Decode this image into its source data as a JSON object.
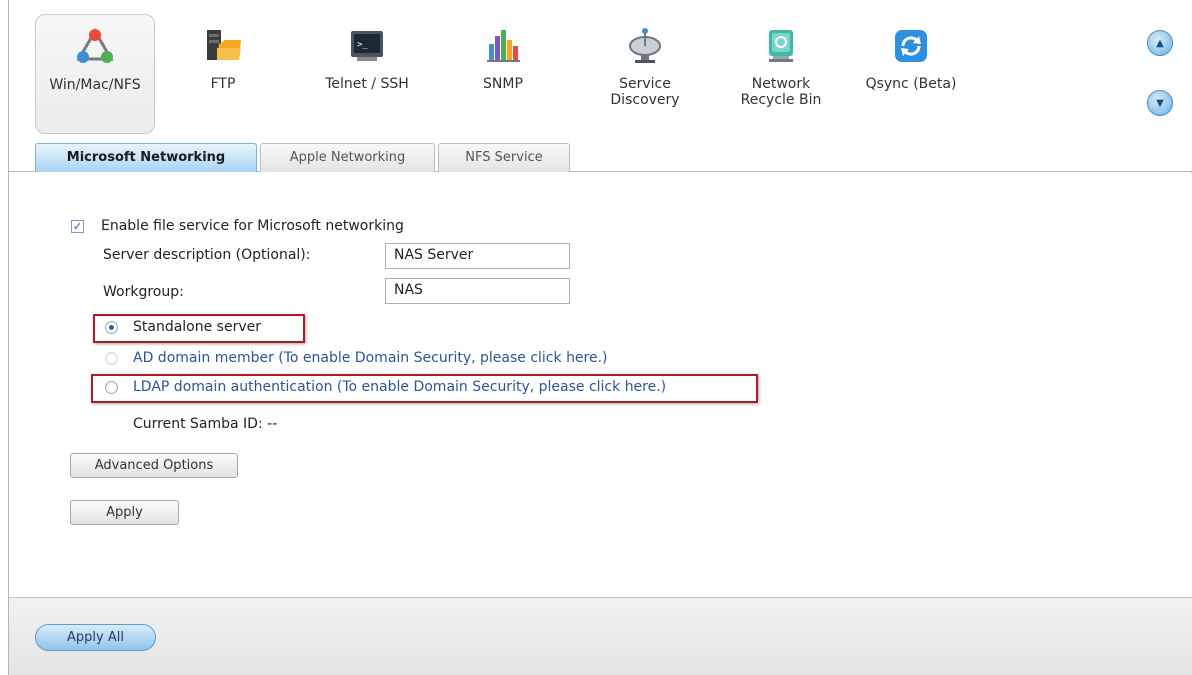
{
  "services": [
    {
      "label": "Win/Mac/NFS",
      "icon": "winmacnfs-icon",
      "active": true
    },
    {
      "label": "FTP",
      "icon": "ftp-folder-icon"
    },
    {
      "label": "Telnet / SSH",
      "icon": "terminal-icon"
    },
    {
      "label": "SNMP",
      "icon": "bar-chart-icon"
    },
    {
      "label": "Service\nDiscovery",
      "icon": "satellite-dish-icon"
    },
    {
      "label": "Network\nRecycle Bin",
      "icon": "recycle-bin-icon"
    },
    {
      "label": "Qsync (Beta)",
      "icon": "sync-icon"
    }
  ],
  "scroll": {
    "up": "▲",
    "down": "▼"
  },
  "tabs": [
    {
      "label": "Microsoft Networking",
      "active": true
    },
    {
      "label": "Apple Networking"
    },
    {
      "label": "NFS Service"
    }
  ],
  "form": {
    "enable_label": "Enable file service for Microsoft networking",
    "enable_checked": true,
    "server_desc_label": "Server description (Optional):",
    "server_desc_value": "NAS Server",
    "workgroup_label": "Workgroup:",
    "workgroup_value": "NAS",
    "radios": [
      {
        "label": "Standalone server",
        "selected": true,
        "highlighted": true
      },
      {
        "label": "AD domain member (To enable Domain Security, please click here.)",
        "selected": false
      },
      {
        "label": "LDAP domain authentication (To enable Domain Security, please click here.)",
        "selected": false,
        "highlighted": true
      }
    ],
    "samba_label": "Current Samba ID:",
    "samba_value": "--",
    "advanced_button": "Advanced Options",
    "apply_button": "Apply"
  },
  "footer": {
    "apply_all": "Apply All"
  },
  "colors": {
    "accent": "#8fc4ec",
    "highlight": "#a81e24",
    "link": "#2b5597"
  }
}
